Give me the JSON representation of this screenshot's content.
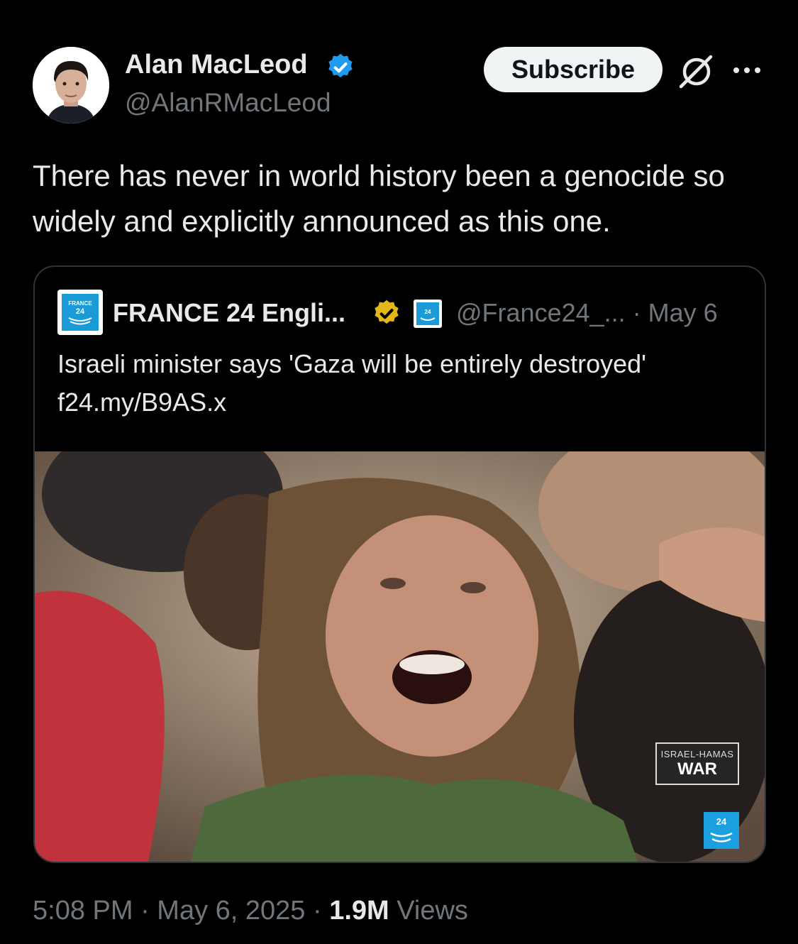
{
  "author": {
    "name": "Alan MacLeod",
    "handle": "@AlanRMacLeod",
    "verified_color": "#1d9bf0"
  },
  "actions": {
    "subscribe_label": "Subscribe",
    "grok_icon": "grok-icon",
    "more_icon": "more-icon"
  },
  "post": {
    "text": "There has never in world history been a genocide so widely and explicitly announced as this one."
  },
  "quote": {
    "name": "FRANCE 24 Engli...",
    "handle_date": "@France24_... · May 6",
    "text_line1": "Israeli minister says 'Gaza will be entirely destroyed'",
    "text_line2": "f24.my/B9AS.x",
    "logo_text": "FRANCE 24",
    "video_badge_line1": "ISRAEL-HAMAS",
    "video_badge_line2": "WAR",
    "gold_check_color": "#e2b719"
  },
  "footer": {
    "time_date": "5:08 PM · May 6, 2025 · ",
    "views_count": "1.9M",
    "views_label": " Views"
  }
}
